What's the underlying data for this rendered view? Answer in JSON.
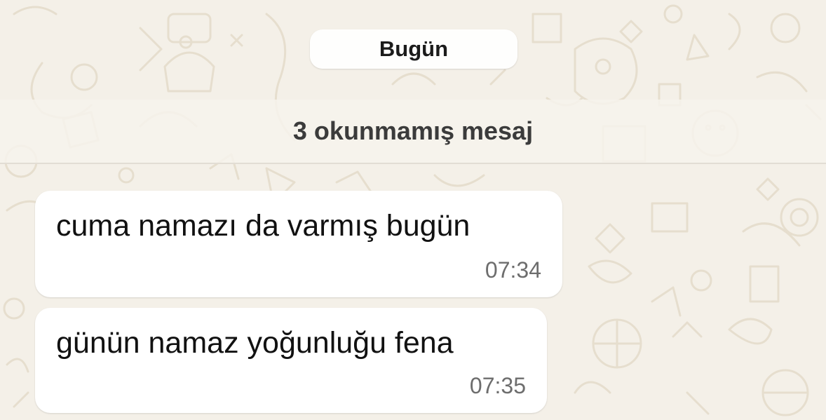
{
  "chat": {
    "date_label": "Bugün",
    "unread_label": "3 okunmamış mesaj",
    "messages": [
      {
        "text": "cuma namazı da varmış bugün",
        "time": "07:34"
      },
      {
        "text": "günün namaz yoğunluğu fena",
        "time": "07:35"
      }
    ]
  },
  "colors": {
    "wallpaper": "#f4f0e8",
    "doodle": "#e8e0d2",
    "bubble": "#ffffff",
    "text": "#111111",
    "time": "#6d6d6d"
  }
}
